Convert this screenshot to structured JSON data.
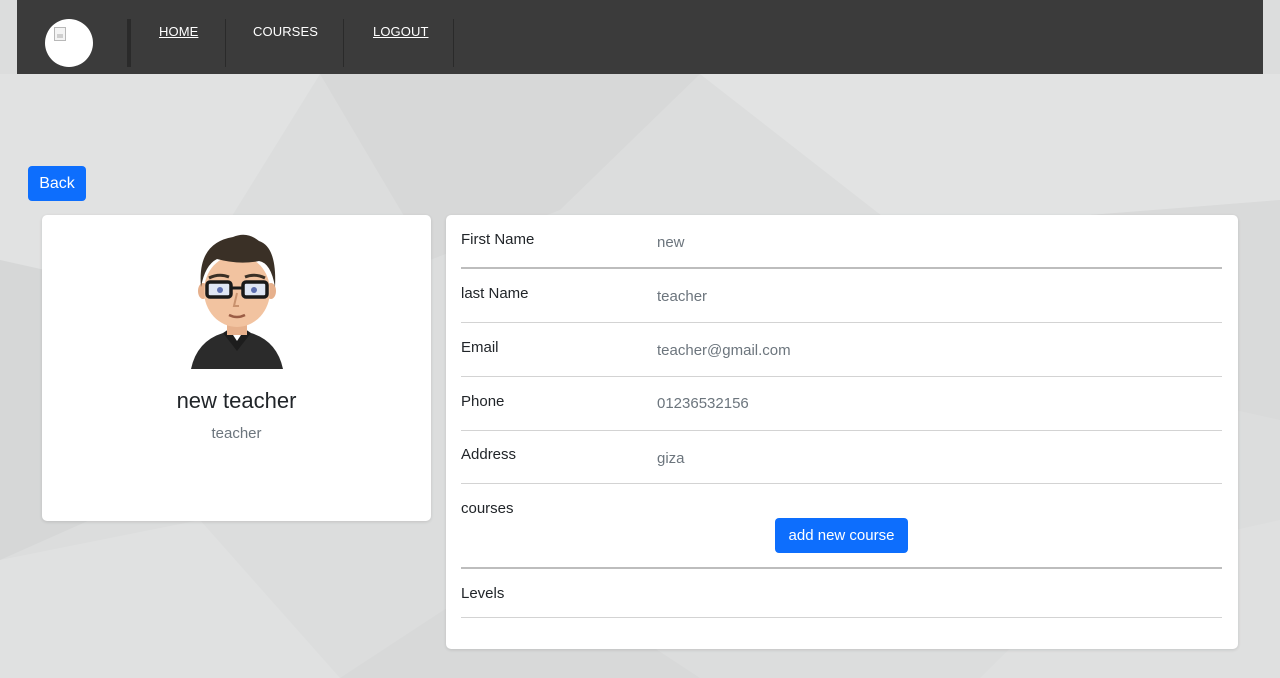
{
  "nav": {
    "links": [
      {
        "label": "HOME"
      },
      {
        "label": "COURSES"
      },
      {
        "label": "LOGOUT"
      }
    ]
  },
  "back_label": "Back",
  "profile": {
    "name": "new teacher",
    "role": "teacher"
  },
  "details": {
    "rows": [
      {
        "label": "First Name",
        "value": "new"
      },
      {
        "label": "last Name",
        "value": "teacher"
      },
      {
        "label": "Email",
        "value": "teacher@gmail.com"
      },
      {
        "label": "Phone",
        "value": "01236532156"
      },
      {
        "label": "Address",
        "value": "giza"
      },
      {
        "label": "courses",
        "value": ""
      },
      {
        "label": "Levels",
        "value": ""
      }
    ],
    "add_course_label": "add new course"
  },
  "colors": {
    "navbar": "#3b3b3b",
    "primary_button": "#0d6efd",
    "page_background": "#dcdddd"
  }
}
